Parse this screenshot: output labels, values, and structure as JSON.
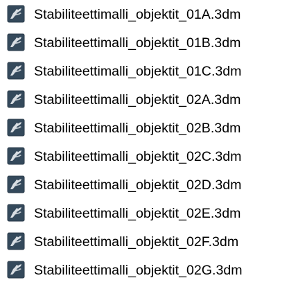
{
  "file_list": {
    "items": [
      {
        "name": "Stabiliteettimalli_objektit_01A.3dm",
        "icon": "rhino-3dm-file-icon"
      },
      {
        "name": "Stabiliteettimalli_objektit_01B.3dm",
        "icon": "rhino-3dm-file-icon"
      },
      {
        "name": "Stabiliteettimalli_objektit_01C.3dm",
        "icon": "rhino-3dm-file-icon"
      },
      {
        "name": "Stabiliteettimalli_objektit_02A.3dm",
        "icon": "rhino-3dm-file-icon"
      },
      {
        "name": "Stabiliteettimalli_objektit_02B.3dm",
        "icon": "rhino-3dm-file-icon"
      },
      {
        "name": "Stabiliteettimalli_objektit_02C.3dm",
        "icon": "rhino-3dm-file-icon"
      },
      {
        "name": "Stabiliteettimalli_objektit_02D.3dm",
        "icon": "rhino-3dm-file-icon"
      },
      {
        "name": "Stabiliteettimalli_objektit_02E.3dm",
        "icon": "rhino-3dm-file-icon"
      },
      {
        "name": "Stabiliteettimalli_objektit_02F.3dm",
        "icon": "rhino-3dm-file-icon"
      },
      {
        "name": "Stabiliteettimalli_objektit_02G.3dm",
        "icon": "rhino-3dm-file-icon"
      }
    ]
  },
  "colors": {
    "icon_background": "#34495b",
    "icon_border": "#2a3a48",
    "icon_figure": "#d9dee3",
    "text": "#000000",
    "background": "#ffffff"
  }
}
